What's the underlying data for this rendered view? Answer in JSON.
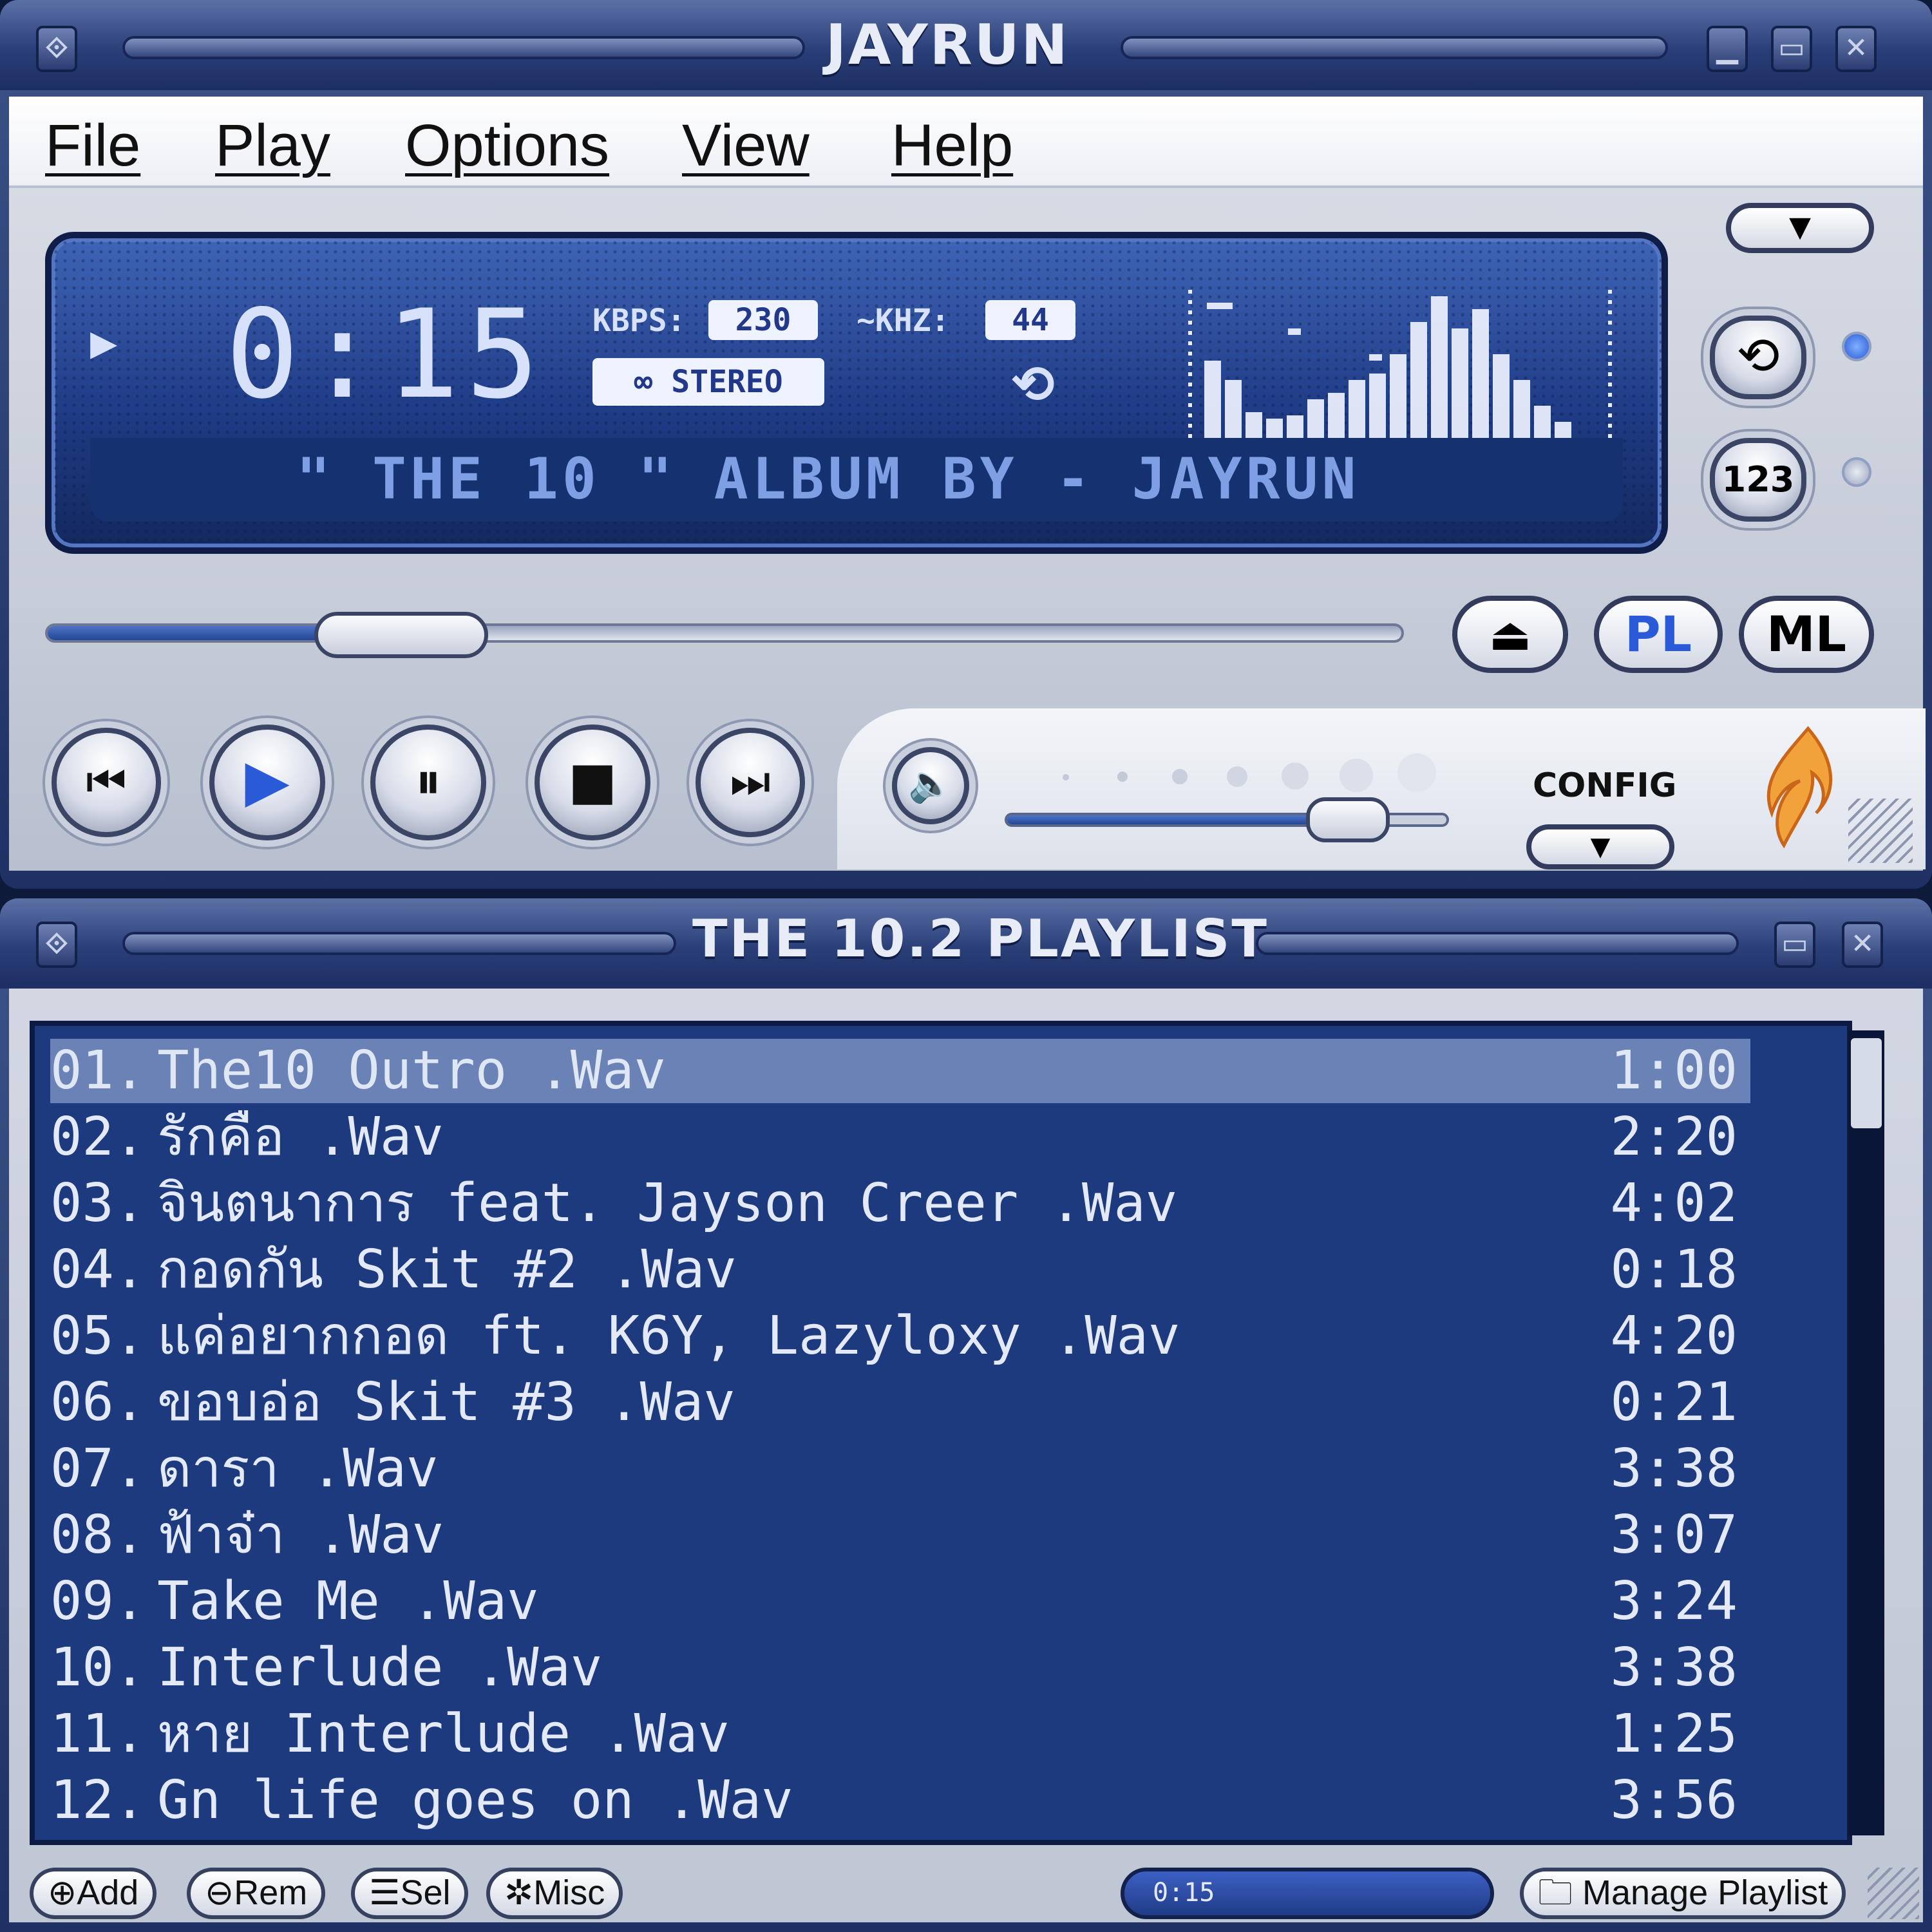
{
  "main_window": {
    "title": "JAYRUN",
    "menu": [
      "File",
      "Play",
      "Options",
      "View",
      "Help"
    ],
    "display": {
      "time": "0:15",
      "kbps_label": "KBPS:",
      "kbps_value": "230",
      "khz_label": "KHZ:",
      "khz_value": "44",
      "stereo_label": "STEREO",
      "ticker": "\" THE 10 \" ALBUM BY - JAYRUN",
      "seek_progress": 0.25,
      "volume_level": 0.78
    },
    "buttons": {
      "eject": "⏏",
      "pl": "PL",
      "ml": "ML",
      "config": "CONFIG",
      "shuffle": "123"
    }
  },
  "playlist_window": {
    "title": "THE 10.2 PLAYLIST",
    "selected_index": 0,
    "tracks": [
      {
        "num": "01.",
        "title": "The10 Outro .Wav",
        "duration": "1:00"
      },
      {
        "num": "02.",
        "title": "รักคือ .Wav",
        "duration": "2:20"
      },
      {
        "num": "03.",
        "title": "จินตนาการ feat. Jayson Creer .Wav",
        "duration": "4:02"
      },
      {
        "num": "04.",
        "title": "กอดกัน Skit #2 .Wav",
        "duration": "0:18"
      },
      {
        "num": "05.",
        "title": "แค่อยากกอด  ft. K6Y, Lazyloxy .Wav",
        "duration": "4:20"
      },
      {
        "num": "06.",
        "title": "ขอบอ่อ Skit #3 .Wav",
        "duration": "0:21"
      },
      {
        "num": "07.",
        "title": "ดารา .Wav",
        "duration": "3:38"
      },
      {
        "num": "08.",
        "title": "ฟ้าจ๋า .Wav",
        "duration": "3:07"
      },
      {
        "num": "09.",
        "title": "Take Me .Wav",
        "duration": "3:24"
      },
      {
        "num": "10.",
        "title": "Interlude .Wav",
        "duration": "3:38"
      },
      {
        "num": "11.",
        "title": "หาย Interlude .Wav",
        "duration": "1:25"
      },
      {
        "num": "12.",
        "title": "Gn life goes on .Wav",
        "duration": "3:56"
      }
    ],
    "footer": {
      "add": "Add",
      "rem": "Rem",
      "sel": "Sel",
      "misc": "Misc",
      "mini_time": "0:15",
      "manage": "Manage Playlist"
    }
  },
  "colors": {
    "lcd": "#1f3c86",
    "accent": "#3d5fc4",
    "playlist_bg": "#1e3a7e",
    "selected_row": "#6a82b5"
  }
}
